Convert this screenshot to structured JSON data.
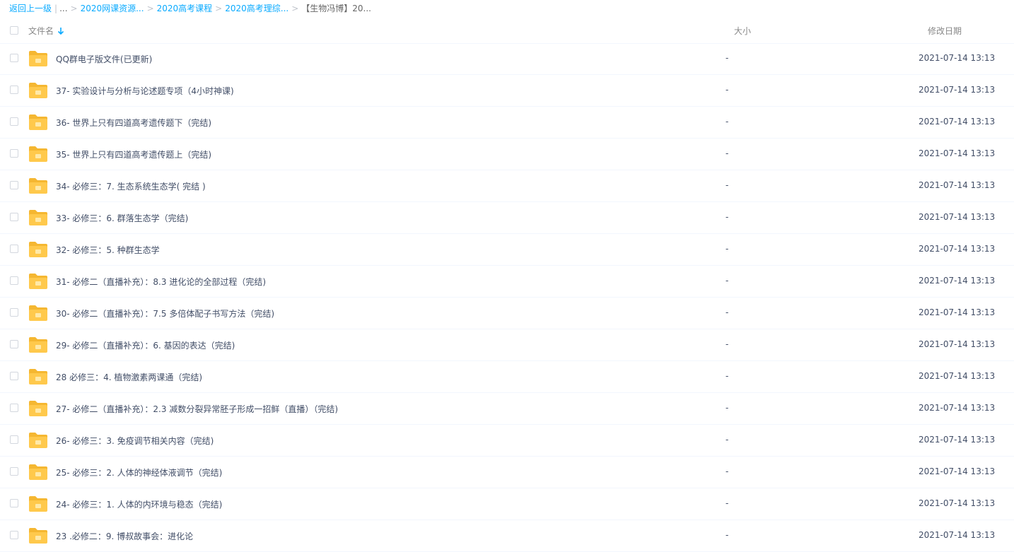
{
  "breadcrumb": {
    "back": "返回上一级",
    "ellipsis": "...",
    "items": [
      "2020网课资源...",
      "2020高考课程",
      "2020高考理综..."
    ],
    "current": "【生物冯博】20..."
  },
  "header": {
    "name": "文件名",
    "size": "大小",
    "date": "修改日期"
  },
  "colors": {
    "link": "#09aaff",
    "folder": "#ffc94c",
    "folder_tab": "#f5b731",
    "text": "#424e67"
  },
  "files": [
    {
      "name": "QQ群电子版文件(已更新)",
      "size": "-",
      "date": "2021-07-14 13:13"
    },
    {
      "name": "37- 实验设计与分析与论述题专项（4小时神课)",
      "size": "-",
      "date": "2021-07-14 13:13"
    },
    {
      "name": "36- 世界上只有四道高考遗传题下（完结)",
      "size": "-",
      "date": "2021-07-14 13:13"
    },
    {
      "name": "35-  世界上只有四道高考遗传题上（完结)",
      "size": "-",
      "date": "2021-07-14 13:13"
    },
    {
      "name": "34- 必修三：7. 生态系统生态学( 完结 )",
      "size": "-",
      "date": "2021-07-14 13:13"
    },
    {
      "name": "33- 必修三：6. 群落生态学（完结)",
      "size": "-",
      "date": "2021-07-14 13:13"
    },
    {
      "name": "32- 必修三：5. 种群生态学",
      "size": "-",
      "date": "2021-07-14 13:13"
    },
    {
      "name": "31- 必修二（直播补充）：8.3 进化论的全部过程（完结)",
      "size": "-",
      "date": "2021-07-14 13:13"
    },
    {
      "name": "30- 必修二（直播补充）：7.5 多倍体配子书写方法（完结)",
      "size": "-",
      "date": "2021-07-14 13:13"
    },
    {
      "name": "29- 必修二（直播补充）：6. 基因的表达（完结)",
      "size": "-",
      "date": "2021-07-14 13:13"
    },
    {
      "name": "28 必修三：4. 植物激素两课通（完结)",
      "size": "-",
      "date": "2021-07-14 13:13"
    },
    {
      "name": "27- 必修二（直播补充）：2.3 减数分裂异常胚子形成一招鲜（直播）（完结)",
      "size": "-",
      "date": "2021-07-14 13:13"
    },
    {
      "name": "26- 必修三：3. 免疫调节相关内容（完结)",
      "size": "-",
      "date": "2021-07-14 13:13"
    },
    {
      "name": "25- 必修三：2. 人体的神经体液调节（完结)",
      "size": "-",
      "date": "2021-07-14 13:13"
    },
    {
      "name": "24- 必修三：1. 人体的内环境与稳态（完结)",
      "size": "-",
      "date": "2021-07-14 13:13"
    },
    {
      "name": "23 .必修二：9. 博叔故事会：进化论",
      "size": "-",
      "date": "2021-07-14 13:13"
    }
  ]
}
